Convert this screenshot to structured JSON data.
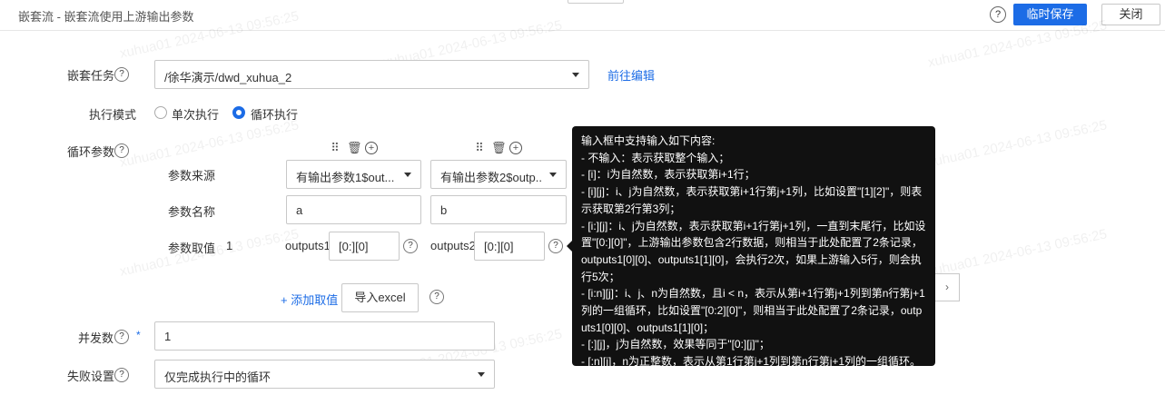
{
  "header": {
    "title": "嵌套流 - 嵌套流使用上游输出参数",
    "help": "?",
    "save_label": "临时保存",
    "close_label": "关闭"
  },
  "form": {
    "nested_task": {
      "label": "嵌套任务",
      "value": "/徐华演示/dwd_xuhua_2",
      "edit_link": "前往编辑"
    },
    "exec_mode": {
      "label": "执行模式",
      "options": [
        "单次执行",
        "循环执行"
      ],
      "selected": "循环执行"
    },
    "loop_params": {
      "label": "循环参数",
      "source_label": "参数来源",
      "name_label": "参数名称",
      "value_label": "参数取值",
      "value_index": "1",
      "columns": [
        {
          "source": "有输出参数1$out...",
          "name": "a",
          "output": "outputs1",
          "value": "[0:][0]"
        },
        {
          "source": "有输出参数2$outp...",
          "name": "b",
          "output": "outputs2",
          "value": "[0:][0]"
        }
      ],
      "add_value_link": "+ 添加取值",
      "import_excel": "导入excel"
    },
    "concurrency": {
      "label": "并发数",
      "required_mark": "*",
      "value": "1"
    },
    "failure": {
      "label": "失败设置",
      "value": "仅完成执行中的循环"
    }
  },
  "tooltip": {
    "lines": [
      "输入框中支持输入如下内容:",
      "- 不输入：表示获取整个输入；",
      "- [i]：i为自然数，表示获取第i+1行；",
      "- [i][j]：i、j为自然数，表示获取第i+1行第j+1列，比如设置\"[1][2]\"，则表示获取第2行第3列；",
      "- [i:][j]：i、j为自然数，表示获取第i+1行第j+1列，一直到末尾行，比如设置\"[0:][0]\"，上游输出参数包含2行数据，则相当于此处配置了2条记录，outputs1[0][0]、outputs1[1][0]，会执行2次，如果上游输入5行，则会执行5次；",
      "- [i:n][j]：i、j、n为自然数，且i < n，表示从第i+1行第j+1列到第n行第j+1列的一组循环，比如设置\"[0:2][0]\"，则相当于此处配置了2条记录，outputs1[0][0]、outputs1[1][0]；",
      "- [:][j]，j为自然数，效果等同于\"[0:][j]\"；",
      "- [:n][j]，n为正整数，表示从第1行第j+1列到第n行第j+1列的一组循环。"
    ]
  },
  "watermark_text": "xuhua01 2024-06-13 09:56:25"
}
